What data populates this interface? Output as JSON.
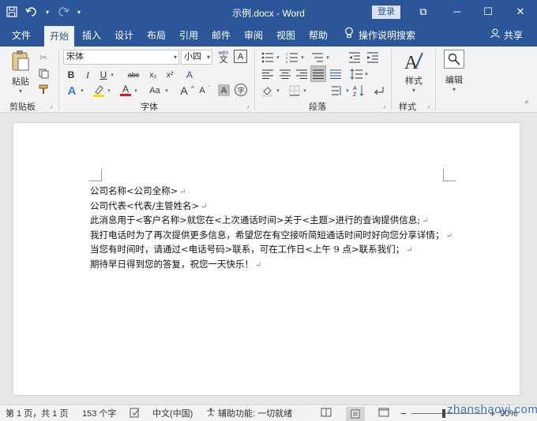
{
  "window": {
    "doc_title": "示例.docx - Word",
    "login_label": "登录",
    "controls": {
      "minimize": "─",
      "maximize": "☐",
      "close": "✕",
      "ribbon_options": "⧉"
    }
  },
  "qat": {
    "save_icon": "save-icon",
    "undo_icon": "undo-icon",
    "redo_icon": "redo-icon",
    "customize_icon": "customize-icon"
  },
  "tabs": [
    {
      "label": "文件"
    },
    {
      "label": "开始"
    },
    {
      "label": "插入"
    },
    {
      "label": "设计"
    },
    {
      "label": "布局"
    },
    {
      "label": "引用"
    },
    {
      "label": "邮件"
    },
    {
      "label": "审阅"
    },
    {
      "label": "视图"
    },
    {
      "label": "帮助"
    }
  ],
  "tell_me": "操作说明搜索",
  "share": "共享",
  "ribbon": {
    "clipboard": {
      "paste": "粘贴",
      "group": "剪贴板"
    },
    "font": {
      "font_name": "宋体",
      "font_size": "小四",
      "wen_label": "wén",
      "wen_char": "文",
      "group": "字体",
      "bold": "B",
      "italic": "I",
      "underline": "U",
      "strike": "abc",
      "subscript": "x₂",
      "superscript": "x²",
      "change_case": "Aa",
      "grow": "A",
      "shrink": "A",
      "clear": "A",
      "char_border": "A",
      "text_effects": "A",
      "font_color": "A",
      "char_shading": "A",
      "enclose": "字"
    },
    "paragraph": {
      "group": "段落"
    },
    "styles": {
      "label": "样式",
      "group": "样式"
    },
    "editing": {
      "label": "编辑"
    }
  },
  "document": {
    "paragraphs": [
      "公司名称<公司全称>",
      "公司代表<代表/主管姓名>",
      "此消息用于<客户名称>就您在<上次通话时间>关于<主题>进行的查询提供信息;",
      "我打电话时为了再次提供更多信息，希望您在有空接听简短通话时间时好向您分享详情；",
      "当您有时间时，请通过<电话号码>联系，可在工作日<上午 9 点>联系我们；",
      "期待早日得到您的答复，祝您一天快乐！"
    ],
    "para_mark": "↵"
  },
  "status": {
    "page": "第 1 页，共 1 页",
    "words": "153 个字",
    "language": "中文(中国)",
    "accessibility": "辅助功能: 一切就绪",
    "zoom": "90%"
  },
  "watermark": "zhanshaoyi.com"
}
